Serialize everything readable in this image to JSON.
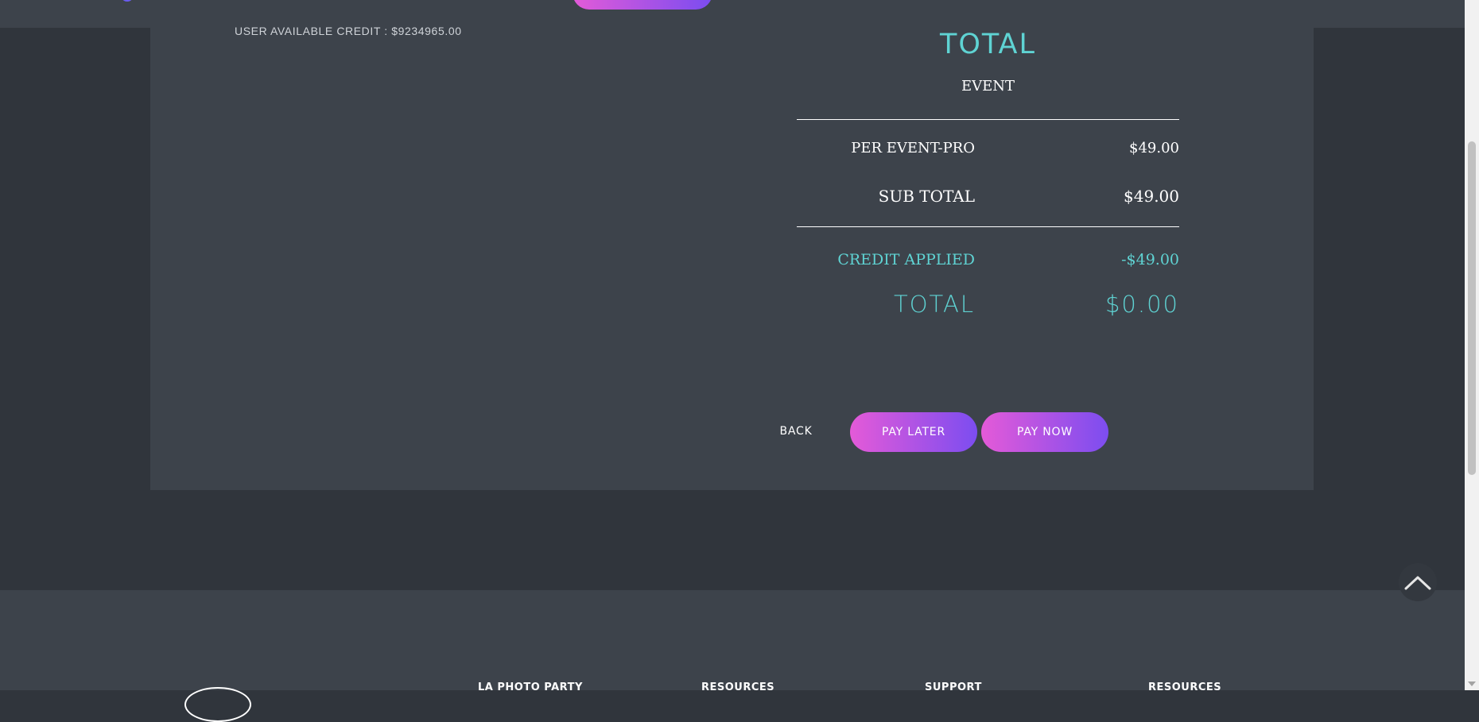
{
  "account": {
    "credit_text": "USER AVAILABLE CREDIT : $9234965.00"
  },
  "summary": {
    "title": "TOTAL",
    "subtitle": "EVENT",
    "rows": {
      "per_event": {
        "label": "PER EVENT-PRO",
        "value": "$49.00"
      },
      "sub_total": {
        "label": "SUB TOTAL",
        "value": "$49.00"
      },
      "credit_applied": {
        "label": "CREDIT APPLIED",
        "value": "-$49.00"
      },
      "total": {
        "label": "TOTAL",
        "value": "$0.00"
      }
    }
  },
  "actions": {
    "back": "BACK",
    "pay_later": "PAY LATER",
    "pay_now": "PAY NOW"
  },
  "footer": {
    "columns": [
      "LA PHOTO PARTY",
      "RESOURCES",
      "SUPPORT",
      "RESOURCES"
    ]
  },
  "icons": {
    "scroll_top": "chevron-up-icon",
    "logo": "logo-icon"
  },
  "colors": {
    "accent": "#5fd3d3",
    "gradient_start": "#e45ad8",
    "gradient_end": "#7c4df0",
    "panel": "#3d434b",
    "page_bg": "#30353c"
  }
}
